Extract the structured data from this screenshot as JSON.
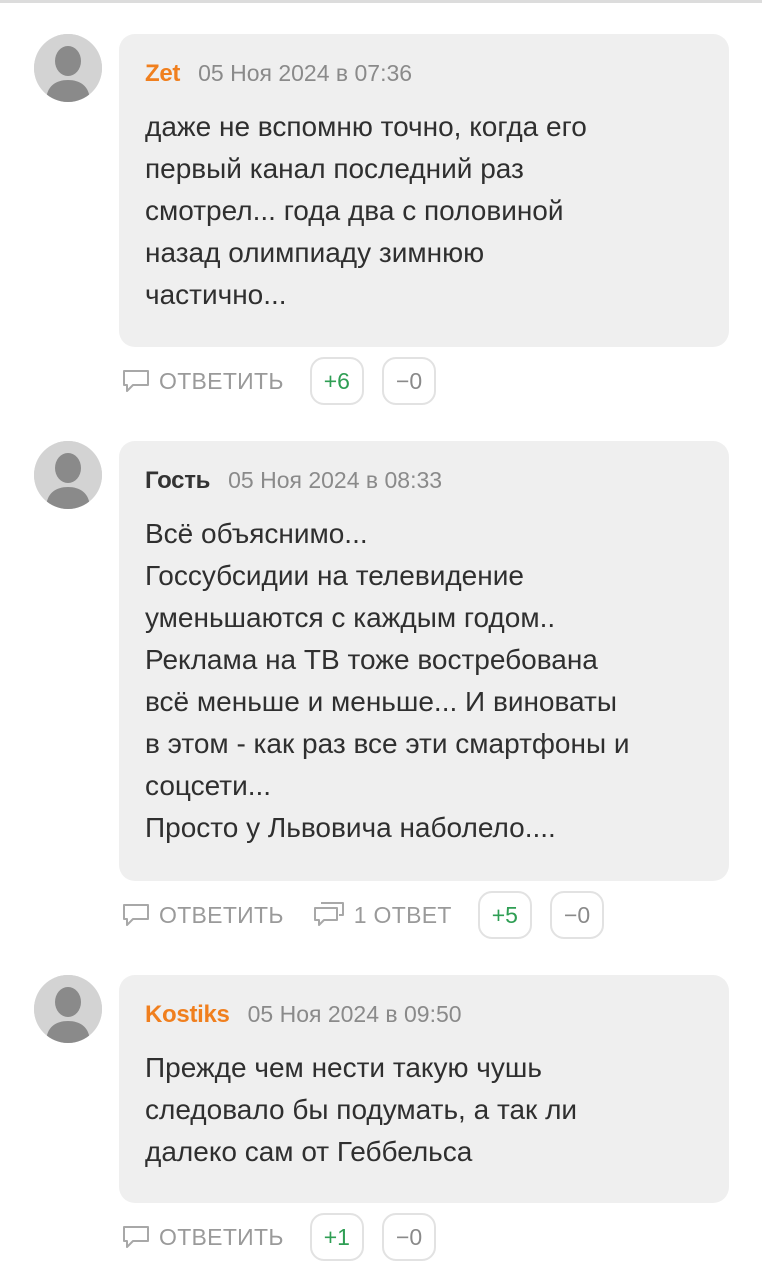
{
  "comments": [
    {
      "author": "Zet",
      "author_color": "#f07f1e",
      "date": "05 Ноя 2024 в 07:36",
      "text": "даже не вспомню точно, когда его\nпервый канал последний раз\nсмотрел... года два с половиной\nназад олимпиаду зимнюю\nчастично...",
      "reply_label": "ОТВЕТИТЬ",
      "likes": "+6",
      "dislikes": "−0"
    },
    {
      "author": "Гость",
      "author_color": "#333333",
      "date": "05 Ноя 2024 в 08:33",
      "text": "Всё объяснимо...\nГоссубсидии на телевидение\nуменьшаются с каждым годом..\nРеклама на ТВ тоже востребована\nвсё меньше и меньше... И виноваты\nв этом - как раз все эти смартфоны и\nсоцсети...\nПросто у Львовича наболело....",
      "reply_label": "ОТВЕТИТЬ",
      "thread_label": "1 ОТВЕТ",
      "likes": "+5",
      "dislikes": "−0"
    },
    {
      "author": "Kostiks",
      "author_color": "#f07f1e",
      "date": "05 Ноя 2024 в 09:50",
      "text": "Прежде чем нести такую чушь\nследовало бы подумать, а так ли\nдалеко сам от Геббельса",
      "reply_label": "ОТВЕТИТЬ",
      "likes": "+1",
      "dislikes": "−0"
    }
  ],
  "icons": {
    "avatar": "user-avatar-icon",
    "reply": "speech-bubble-icon",
    "thread": "speech-bubbles-icon"
  }
}
